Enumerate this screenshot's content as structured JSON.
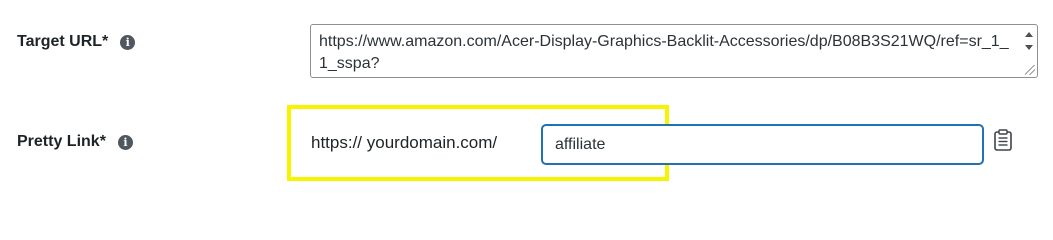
{
  "target_url": {
    "label": "Target URL*",
    "value": "https://www.amazon.com/Acer-Display-Graphics-Backlit-Accessories/dp/B08B3S21WQ/ref=sr_1_1_sspa?"
  },
  "pretty_link": {
    "label": "Pretty Link*",
    "prefix": "https:// yourdomain.com/",
    "slug": "affiliate"
  },
  "colors": {
    "highlight": "#f7f400",
    "input_focus_border": "#2271b1",
    "icon": "#50575e"
  },
  "icons": {
    "info": "info-icon",
    "copy": "clipboard-icon"
  }
}
